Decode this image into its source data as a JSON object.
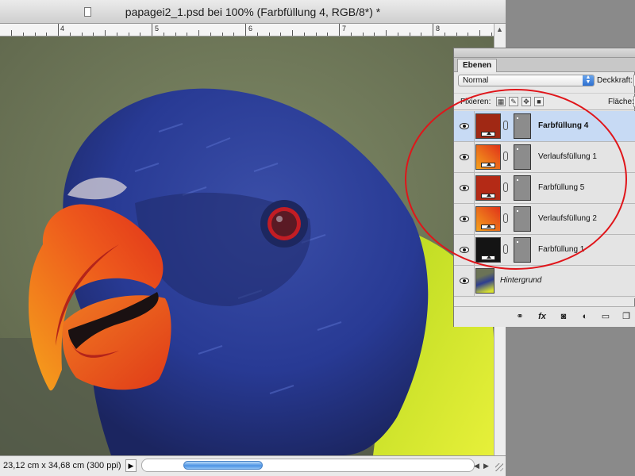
{
  "window": {
    "title": "papagei2_1.psd bei 100% (Farbfüllung 4, RGB/8*) *"
  },
  "ruler": {
    "labels": [
      "4",
      "5",
      "6",
      "7",
      "8"
    ]
  },
  "status": {
    "doc_size": "23,12 cm x 34,68 cm (300 ppi)",
    "arrow": "▶"
  },
  "layers_panel": {
    "tab_label": "Ebenen",
    "blend_mode": "Normal",
    "opacity_label": "Deckkraft:",
    "lock_label": "Fixieren:",
    "fill_label": "Fläche:",
    "layers": [
      {
        "name": "Farbfüllung 4",
        "thumb_color": "#a02814",
        "selected": true
      },
      {
        "name": "Verlaufsfüllung 1",
        "thumb_color": "gradient",
        "selected": false
      },
      {
        "name": "Farbfüllung 5",
        "thumb_color": "#b42a16",
        "selected": false
      },
      {
        "name": "Verlaufsfüllung 2",
        "thumb_color": "gradient",
        "selected": false
      },
      {
        "name": "Farbfüllung 1",
        "thumb_color": "#141414",
        "selected": false
      },
      {
        "name": "Hintergrund",
        "thumb_color": "photo",
        "selected": false
      }
    ],
    "bottom_icons": [
      "link-icon",
      "fx-icon",
      "mask-icon",
      "adjustment-icon",
      "group-icon",
      "new-layer-icon"
    ]
  },
  "icons": {
    "fx": "fx"
  },
  "colors": {
    "annotation": "#e0151a",
    "selected_row": "#c7daf4",
    "scroll_thumb": "#4c93e4"
  }
}
